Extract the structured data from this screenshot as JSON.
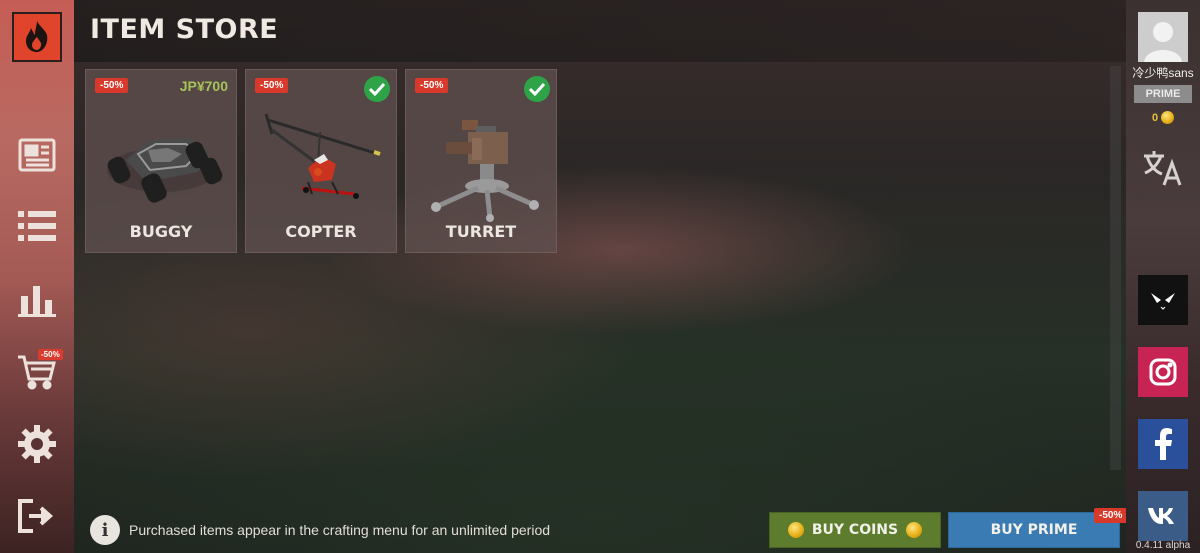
{
  "header": {
    "title": "ITEM STORE"
  },
  "sidebar": {
    "cart_badge": "-50%"
  },
  "store": {
    "items": [
      {
        "name": "BUGGY",
        "discount": "-50%",
        "price": "JP¥700",
        "owned": false
      },
      {
        "name": "COPTER",
        "discount": "-50%",
        "price": "",
        "owned": true
      },
      {
        "name": "TURRET",
        "discount": "-50%",
        "price": "",
        "owned": true
      }
    ]
  },
  "footer": {
    "info_text": "Purchased items appear in the crafting menu for an unlimited period",
    "buy_coins_label": "BUY COINS",
    "buy_prime_label": "BUY PRIME",
    "buy_prime_badge": "-50%"
  },
  "profile": {
    "username": "冷少鸭sans",
    "prime_status": "PRIME",
    "coins": "0"
  },
  "version": "0.4.11 alpha",
  "colors": {
    "discount": "#d9392b",
    "price": "#a8c25b",
    "owned": "#2fa348",
    "buy_coins": "#5d7c2d",
    "buy_prime": "#3a7bb3"
  },
  "icons": {
    "logo": "flame-icon",
    "sidebar": [
      "news-icon",
      "list-icon",
      "stats-icon",
      "cart-icon",
      "gear-icon",
      "exit-icon"
    ],
    "social": [
      "alien-icon",
      "instagram-icon",
      "facebook-icon",
      "vk-icon"
    ]
  }
}
